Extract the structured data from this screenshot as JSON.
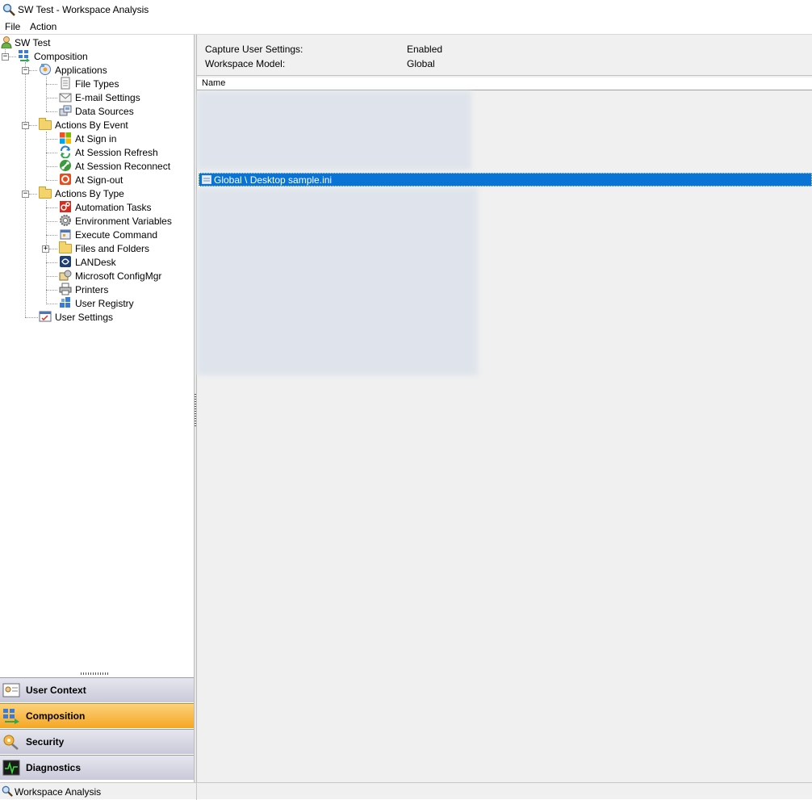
{
  "window": {
    "title": "SW Test - Workspace Analysis"
  },
  "menu": [
    "File",
    "Action"
  ],
  "tree": {
    "root": "SW Test",
    "composition": "Composition",
    "applications": "Applications",
    "file_types": "File Types",
    "email_settings": "E-mail Settings",
    "data_sources": "Data Sources",
    "actions_by_event": "Actions By Event",
    "at_sign_in": "At Sign in",
    "at_session_refresh": "At Session Refresh",
    "at_session_reconnect": "At Session Reconnect",
    "at_sign_out": "At Sign-out",
    "actions_by_type": "Actions By Type",
    "automation_tasks": "Automation Tasks",
    "environment_variables": "Environment Variables",
    "execute_command": "Execute Command",
    "files_and_folders": "Files and Folders",
    "landesk": "LANDesk",
    "microsoft_configmgr": "Microsoft ConfigMgr",
    "printers": "Printers",
    "user_registry": "User Registry",
    "user_settings": "User Settings"
  },
  "nav": {
    "user_context": "User Context",
    "composition": "Composition",
    "security": "Security",
    "diagnostics": "Diagnostics"
  },
  "properties": {
    "capture_label": "Capture User Settings:",
    "capture_value": "Enabled",
    "model_label": "Workspace Model:",
    "model_value": "Global"
  },
  "list": {
    "column_name": "Name",
    "selected_item": "Global \\ Desktop sample.ini"
  },
  "status": {
    "text": "Workspace Analysis"
  },
  "colors": {
    "selection": "#0a74d4",
    "active_nav": "#f5a623"
  }
}
